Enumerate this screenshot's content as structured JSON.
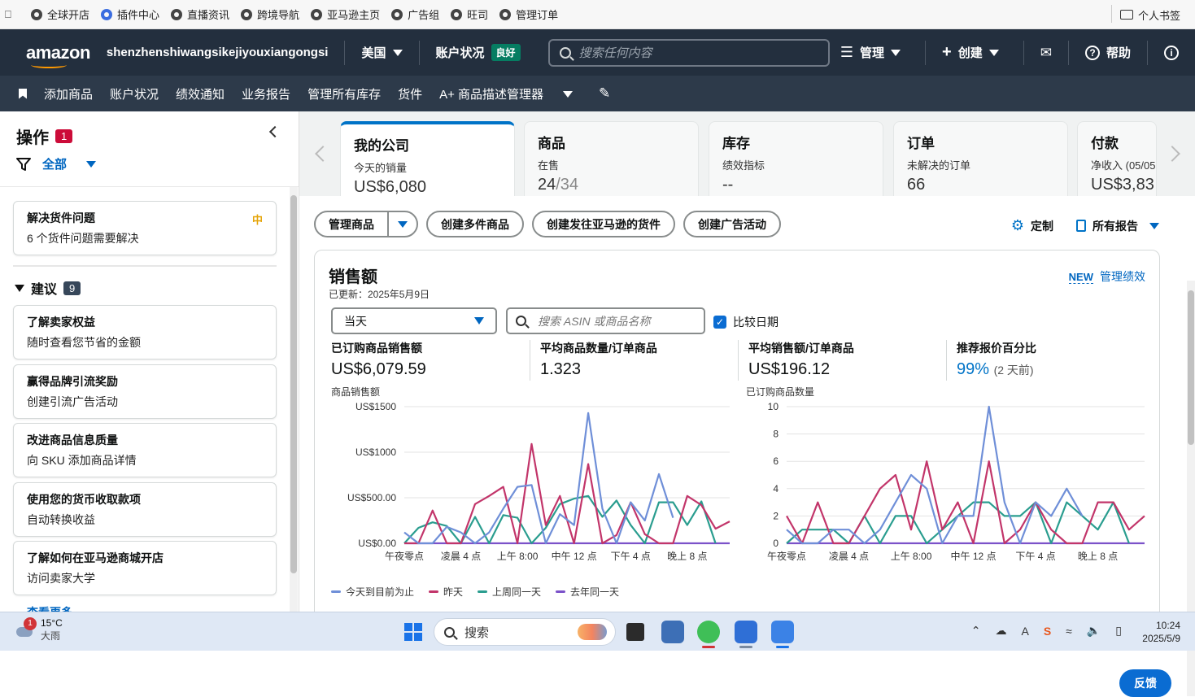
{
  "bookmarks": {
    "items": [
      "全球开店",
      "插件中心",
      "直播资讯",
      "跨境导航",
      "亚马逊主页",
      "广告组",
      "旺司",
      "管理订单"
    ],
    "right_label": "个人书签"
  },
  "topbar": {
    "logo": "amazon",
    "store_name": "shenzhenshiwangsikejiyouxiangongsi",
    "region": "美国",
    "account_status_label": "账户状况",
    "account_status_badge": "良好",
    "search_placeholder": "搜索任何内容",
    "manage_label": "管理",
    "create_label": "创建",
    "help_label": "帮助"
  },
  "navbar": {
    "items": [
      "添加商品",
      "账户状况",
      "绩效通知",
      "业务报告",
      "管理所有库存",
      "货件",
      "A+ 商品描述管理器"
    ]
  },
  "sidebar": {
    "title": "操作",
    "title_count": "1",
    "filter_label": "全部",
    "issue_card": {
      "title": "解决货件问题",
      "subtitle": "6 个货件问题需要解决",
      "tag": "中"
    },
    "suggestions_label": "建议",
    "suggestions_count": "9",
    "cards": [
      {
        "title": "了解卖家权益",
        "subtitle": "随时查看您节省的金额"
      },
      {
        "title": "赢得品牌引流奖励",
        "subtitle": "创建引流广告活动"
      },
      {
        "title": "改进商品信息质量",
        "subtitle": "向 SKU 添加商品详情"
      },
      {
        "title": "使用您的货币收取款项",
        "subtitle": "自动转换收益"
      },
      {
        "title": "了解如何在亚马逊商城开店",
        "subtitle": "访问卖家大学"
      }
    ],
    "more_label": "查看更多"
  },
  "tabs": [
    {
      "title": "我的公司",
      "subtitle": "今天的销量",
      "value": "US$6,080"
    },
    {
      "title": "商品",
      "subtitle": "在售",
      "value": "24",
      "value_dim": "/34"
    },
    {
      "title": "库存",
      "subtitle": "绩效指标",
      "value": "--"
    },
    {
      "title": "订单",
      "subtitle": "未解决的订单",
      "value": "66"
    },
    {
      "title": "付款",
      "subtitle": "净收入 (05/05 -",
      "value": "US$3,83"
    }
  ],
  "actions": {
    "manage_products": "管理商品",
    "create_multi": "创建多件商品",
    "create_shipment": "创建发往亚马逊的货件",
    "create_ad": "创建广告活动",
    "customize": "定制",
    "all_reports": "所有报告"
  },
  "panel": {
    "title": "销售额",
    "updated": "已更新：2025年5月9日",
    "new_tag": "NEW",
    "manage_perf": "管理绩效",
    "period": "当天",
    "asin_placeholder": "搜索 ASIN 或商品名称",
    "compare_label": "比较日期",
    "metrics": [
      {
        "label": "已订购商品销售额",
        "value": "US$6,079.59"
      },
      {
        "label": "平均商品数量/订单商品",
        "value": "1.323"
      },
      {
        "label": "平均销售额/订单商品",
        "value": "US$196.12"
      },
      {
        "label": "推荐报价百分比",
        "value": "99%",
        "sub": "(2 天前)"
      }
    ],
    "feedback": "反馈"
  },
  "chart_data": [
    {
      "type": "line",
      "title": "商品销售额",
      "ylim": [
        0,
        1500
      ],
      "yticks": [
        "US$0.00",
        "US$500.00",
        "US$1000",
        "US$1500"
      ],
      "xticks": [
        "午夜零点",
        "凌晨 4 点",
        "上午 8:00",
        "中午 12 点",
        "下午 4 点",
        "晚上 8 点"
      ],
      "x": [
        0,
        1,
        2,
        3,
        4,
        5,
        6,
        7,
        8,
        9,
        10,
        11,
        12,
        13,
        14,
        15,
        16,
        17,
        18,
        19,
        20,
        21,
        22,
        23
      ],
      "series": [
        {
          "name": "今天到目前为止",
          "color": "#6f8fd8",
          "values": [
            120,
            0,
            0,
            180,
            120,
            0,
            120,
            380,
            620,
            640,
            0,
            320,
            200,
            1430,
            380,
            0,
            450,
            250,
            760,
            280,
            null,
            null,
            null,
            null
          ]
        },
        {
          "name": "昨天",
          "color": "#c2356a",
          "values": [
            0,
            0,
            360,
            0,
            0,
            430,
            520,
            620,
            0,
            1090,
            200,
            520,
            0,
            870,
            0,
            90,
            450,
            100,
            0,
            0,
            520,
            420,
            160,
            240
          ]
        },
        {
          "name": "上周同一天",
          "color": "#2a9d8f",
          "values": [
            0,
            170,
            230,
            190,
            0,
            290,
            0,
            310,
            280,
            0,
            170,
            430,
            490,
            520,
            290,
            470,
            200,
            0,
            450,
            450,
            200,
            460,
            0,
            null
          ]
        },
        {
          "name": "去年同一天",
          "color": "#7b52c9",
          "values": [
            0,
            0,
            0,
            0,
            0,
            0,
            0,
            0,
            0,
            0,
            0,
            0,
            0,
            0,
            0,
            0,
            0,
            0,
            0,
            0,
            0,
            0,
            0,
            0
          ]
        }
      ]
    },
    {
      "type": "line",
      "title": "已订购商品数量",
      "ylim": [
        0,
        10
      ],
      "yticks": [
        "0",
        "2",
        "4",
        "6",
        "8",
        "10"
      ],
      "xticks": [
        "午夜零点",
        "凌晨 4 点",
        "上午 8:00",
        "中午 12 点",
        "下午 4 点",
        "晚上 8 点"
      ],
      "x": [
        0,
        1,
        2,
        3,
        4,
        5,
        6,
        7,
        8,
        9,
        10,
        11,
        12,
        13,
        14,
        15,
        16,
        17,
        18,
        19,
        20,
        21,
        22,
        23
      ],
      "series": [
        {
          "name": "今天到目前为止",
          "color": "#6f8fd8",
          "values": [
            1,
            0,
            0,
            1,
            1,
            0,
            1,
            3,
            5,
            4,
            0,
            2,
            2,
            10,
            3,
            0,
            3,
            2,
            4,
            2,
            null,
            null,
            null,
            null
          ]
        },
        {
          "name": "昨天",
          "color": "#c2356a",
          "values": [
            2,
            0,
            3,
            0,
            0,
            2,
            4,
            5,
            1,
            6,
            1,
            3,
            0,
            6,
            0,
            1,
            3,
            1,
            0,
            0,
            3,
            3,
            1,
            2
          ]
        },
        {
          "name": "上周同一天",
          "color": "#2a9d8f",
          "values": [
            0,
            1,
            1,
            1,
            0,
            2,
            0,
            2,
            2,
            0,
            1,
            2,
            3,
            3,
            2,
            2,
            3,
            0,
            3,
            2,
            1,
            3,
            0,
            null
          ]
        },
        {
          "name": "去年同一天",
          "color": "#7b52c9",
          "values": [
            0,
            0,
            0,
            0,
            0,
            0,
            0,
            0,
            0,
            0,
            0,
            0,
            0,
            0,
            0,
            0,
            0,
            0,
            0,
            0,
            0,
            0,
            0,
            0
          ]
        }
      ]
    }
  ],
  "taskbar": {
    "temp": "15°C",
    "weather": "大雨",
    "weather_badge": "1",
    "search_label": "搜索",
    "time": "10:24",
    "date": "2025/5/9"
  },
  "colors": {
    "accent": "#0073c7",
    "header_bg": "#232f3e",
    "nav_bg": "#2d3a4a",
    "good": "#067d62",
    "badge_red": "#cc0c39"
  }
}
